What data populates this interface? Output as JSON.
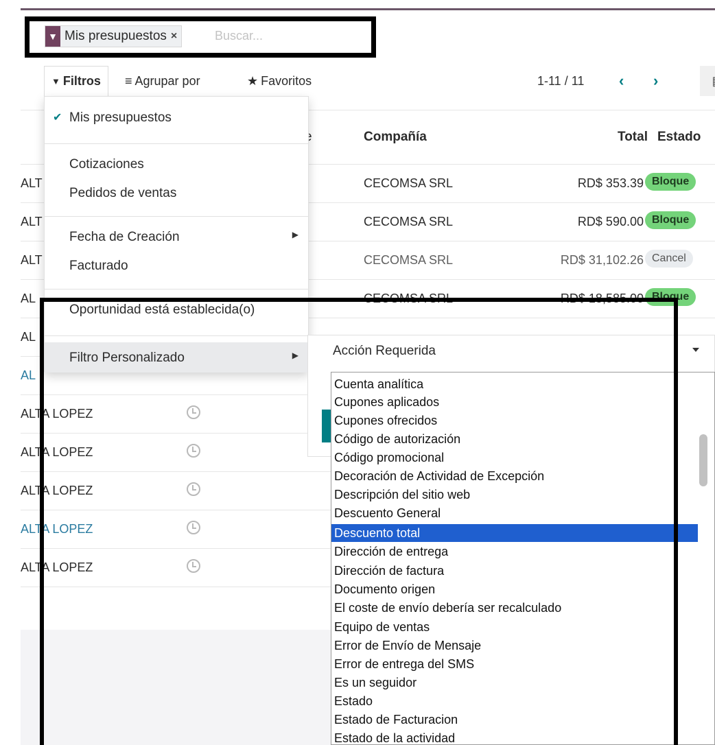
{
  "search": {
    "facet_label": "Mis presupuestos",
    "facet_remove": "×",
    "placeholder": "Buscar..."
  },
  "control_panel": {
    "filters_label": "Filtros",
    "group_by_label": "Agrupar por",
    "favorites_label": "Favoritos",
    "pager_value": "1-11 / 11",
    "prev": "‹",
    "next": "›"
  },
  "table": {
    "headers": {
      "company": "Compañía",
      "total": "Total",
      "status": "Estado",
      "partial": "e"
    },
    "rows": [
      {
        "name": "ALT",
        "company": "CECOMSA SRL",
        "total": "RD$ 353.39",
        "status": "Bloque"
      },
      {
        "name": "ALT",
        "company": "CECOMSA SRL",
        "total": "RD$ 590.00",
        "status": "Bloque"
      },
      {
        "name": "ALT",
        "company": "CECOMSA SRL",
        "total": "RD$ 31,102.26",
        "status": "Cancel"
      },
      {
        "name": "AL",
        "company": "CECOMSA SRL",
        "total": "RD$ 18,585.00",
        "status": "Bloque"
      },
      {
        "name": "AL",
        "company": "",
        "total": "",
        "status": ""
      },
      {
        "name": "AL",
        "company": "",
        "total": "",
        "status": ""
      },
      {
        "name": "ALTA LOPEZ",
        "company": "",
        "total": "",
        "status": ""
      },
      {
        "name": "ALTA LOPEZ",
        "company": "",
        "total": "",
        "status": ""
      },
      {
        "name": "ALTA LOPEZ",
        "company": "",
        "total": "",
        "status": ""
      },
      {
        "name": "ALTA LOPEZ",
        "company": "",
        "total": "",
        "status": ""
      },
      {
        "name": "ALTA LOPEZ",
        "company": "",
        "total": "",
        "status": ""
      }
    ]
  },
  "filters_menu": {
    "items": [
      {
        "label": "Mis presupuestos",
        "checked": true
      },
      {
        "label": "Cotizaciones"
      },
      {
        "label": "Pedidos de ventas"
      },
      {
        "label": "Fecha de Creación"
      },
      {
        "label": "Facturado"
      },
      {
        "label": "Oportunidad está establecida(o)"
      },
      {
        "label": "Filtro Personalizado"
      }
    ]
  },
  "custom_filter": {
    "selected_field": "Acción Requerida",
    "options": [
      "Cuenta analítica",
      "Cupones aplicados",
      "Cupones ofrecidos",
      "Código de autorización",
      "Código promocional",
      "Decoración de Actividad de Excepción",
      "Descripción del sitio web",
      "Descuento General",
      "Descuento total",
      "Dirección de entrega",
      "Dirección de factura",
      "Documento origen",
      "El coste de envío debería ser recalculado",
      "Equipo de ventas",
      "Error de Envío de Mensaje",
      "Error de entrega del SMS",
      "Es un seguidor",
      "Estado",
      "Estado de Facturacion",
      "Estado de la actividad"
    ],
    "highlighted_option": "Descuento total"
  },
  "colors": {
    "brand": "#71425f",
    "accent": "#017e84",
    "badge_green": "#74d37a",
    "selection": "#1f5fcf"
  }
}
